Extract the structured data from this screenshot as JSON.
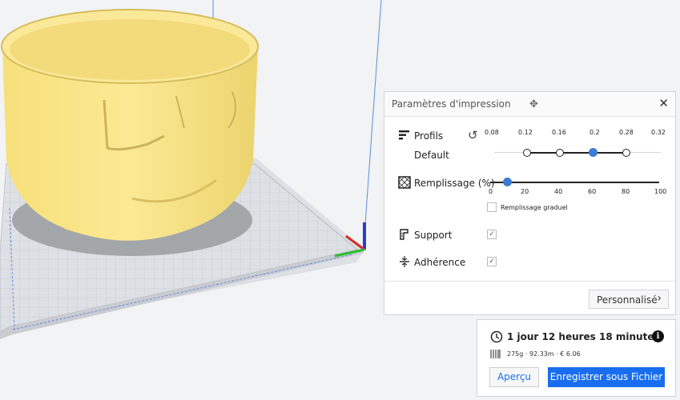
{
  "print_settings": {
    "title": "Paramètres d'impression",
    "profiles_label": "Profils",
    "profile_value": "Default",
    "layer_heights": [
      "0.08",
      "0.12",
      "0.16",
      "0.2",
      "0.28",
      "0.32"
    ],
    "selected_layer_height": "0.2",
    "infill_label": "Remplissage (%)",
    "infill_ticks": [
      "0",
      "20",
      "40",
      "60",
      "80",
      "100"
    ],
    "infill_value": 10,
    "gradual_infill_label": "Remplissage graduel",
    "gradual_infill_checked": false,
    "support_label": "Support",
    "support_checked": true,
    "adhesion_label": "Adhérence",
    "adhesion_checked": true,
    "custom_button": "Personnalisé"
  },
  "output": {
    "time": "1 jour 12 heures 18 minutes",
    "material": "275g · 92.33m · € 6.06",
    "preview_button": "Aperçu",
    "save_button": "Enregistrer sous Fichier"
  },
  "colors": {
    "accent": "#196ef0",
    "model": "#f9e58a",
    "handle": "#3a7bd5"
  }
}
